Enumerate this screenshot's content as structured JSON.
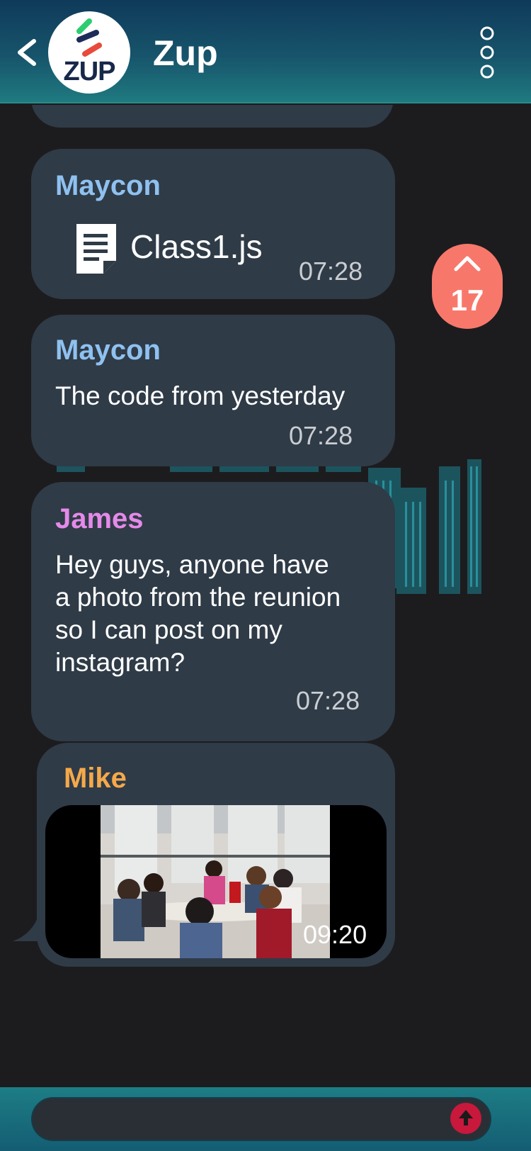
{
  "header": {
    "title": "Zup",
    "logo_text": "ZUP"
  },
  "scroll_badge": {
    "count": "17"
  },
  "messages": [
    {
      "sender": "Maycon",
      "type": "file",
      "file_name": "Class1.js",
      "time": "07:28"
    },
    {
      "sender": "Maycon",
      "type": "text",
      "text": "The code from yesterday",
      "time": "07:28"
    },
    {
      "sender": "James",
      "type": "text",
      "lines": [
        "Hey guys, anyone have",
        "a photo from the reunion",
        "so I can post on my",
        "instagram?"
      ],
      "time": "07:28"
    },
    {
      "sender": "Mike",
      "type": "image",
      "time": "09:20"
    }
  ],
  "colors": {
    "maycon": "#8fc1f0",
    "james": "#e58ae8",
    "mike": "#f5a94a",
    "badge": "#f7786b",
    "send": "#c8183c"
  },
  "icons": {
    "back": "back-icon",
    "menu": "more-vertical-icon",
    "file": "file-icon",
    "send": "send-icon"
  }
}
